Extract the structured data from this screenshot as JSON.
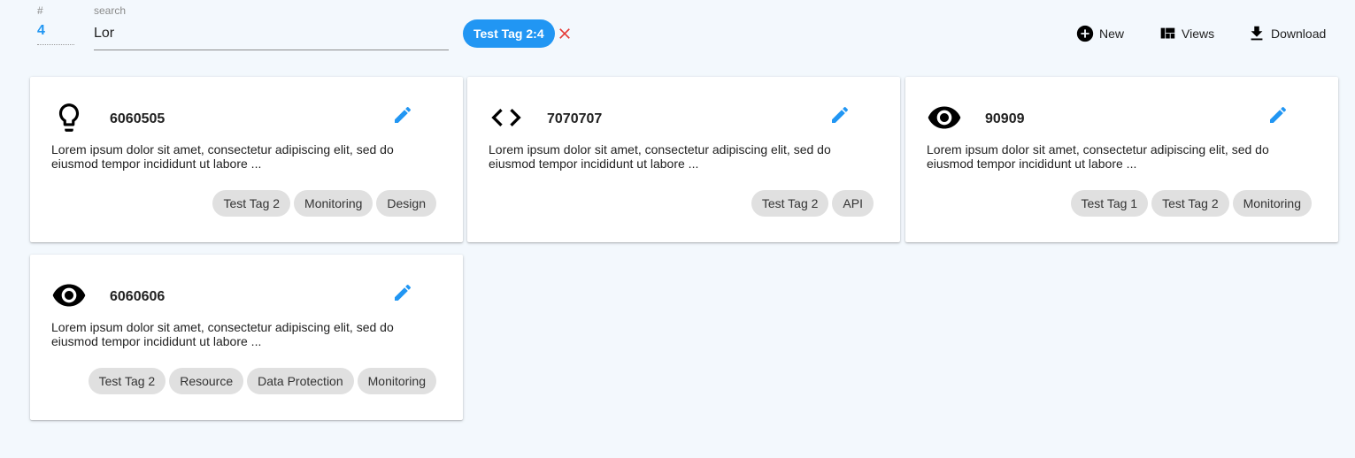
{
  "toolbar": {
    "count_label": "#",
    "count_value": "4",
    "search_label": "search",
    "search_value": "Lor",
    "active_filter": "Test Tag 2:4",
    "new_label": "New",
    "views_label": "Views",
    "download_label": "Download"
  },
  "colors": {
    "accent": "#2196f3",
    "clear": "#e53935",
    "tag_bg": "#e0e0e0",
    "page_bg": "#f3f8fd"
  },
  "cards": [
    {
      "icon": "lightbulb-icon",
      "title": "6060505",
      "description": "Lorem ipsum dolor sit amet, consectetur adipiscing elit, sed do eiusmod tempor incididunt ut labore ...",
      "tags": [
        "Test Tag 2",
        "Monitoring",
        "Design"
      ]
    },
    {
      "icon": "code-icon",
      "title": "7070707",
      "description": "Lorem ipsum dolor sit amet, consectetur adipiscing elit, sed do eiusmod tempor incididunt ut labore ...",
      "tags": [
        "Test Tag 2",
        "API"
      ]
    },
    {
      "icon": "eye-icon",
      "title": "90909",
      "description": "Lorem ipsum dolor sit amet, consectetur adipiscing elit, sed do eiusmod tempor incididunt ut labore ...",
      "tags": [
        "Test Tag 1",
        "Test Tag 2",
        "Monitoring"
      ]
    },
    {
      "icon": "eye-icon",
      "title": "6060606",
      "description": "Lorem ipsum dolor sit amet, consectetur adipiscing elit, sed do eiusmod tempor incididunt ut labore ...",
      "tags": [
        "Test Tag 2",
        "Resource",
        "Data Protection",
        "Monitoring"
      ]
    }
  ]
}
